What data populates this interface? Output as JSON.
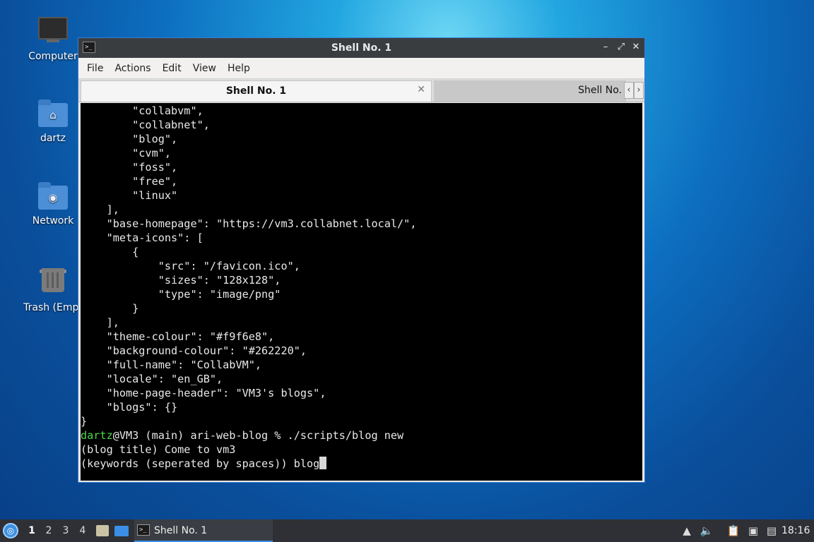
{
  "desktop": {
    "icons": [
      {
        "label": "Computer",
        "icon": "computer-icon"
      },
      {
        "label": "dartz",
        "icon": "home-folder-icon"
      },
      {
        "label": "Network",
        "icon": "network-folder-icon"
      },
      {
        "label": "Trash (Empt",
        "icon": "trash-icon"
      }
    ]
  },
  "window": {
    "title": "Shell No. 1",
    "menu": [
      "File",
      "Actions",
      "Edit",
      "View",
      "Help"
    ],
    "tabs": [
      {
        "label": "Shell No. 1",
        "active": true
      },
      {
        "label": "Shell No.",
        "active": false
      }
    ],
    "terminal_lines": [
      "        \"collabvm\",",
      "        \"collabnet\",",
      "        \"blog\",",
      "        \"cvm\",",
      "        \"foss\",",
      "        \"free\",",
      "        \"linux\"",
      "    ],",
      "    \"base-homepage\": \"https://vm3.collabnet.local/\",",
      "    \"meta-icons\": [",
      "        {",
      "            \"src\": \"/favicon.ico\",",
      "            \"sizes\": \"128x128\",",
      "            \"type\": \"image/png\"",
      "        }",
      "    ],",
      "    \"theme-colour\": \"#f9f6e8\",",
      "    \"background-colour\": \"#262220\",",
      "    \"full-name\": \"CollabVM\",",
      "    \"locale\": \"en_GB\",",
      "    \"home-page-header\": \"VM3's blogs\",",
      "    \"blogs\": {}",
      "}"
    ],
    "prompt": {
      "user": "dartz",
      "rest": "@VM3 (main) ari-web-blog % ./scripts/blog new"
    },
    "after_prompt_lines": [
      "(blog title) Come to vm3",
      "(keywords (seperated by spaces)) blog"
    ]
  },
  "taskbar": {
    "workspaces": [
      "1",
      "2",
      "3",
      "4"
    ],
    "active_workspace": "1",
    "task_label": "Shell No. 1",
    "clock": "18:16"
  },
  "colors": {
    "terminal_bg": "#000000",
    "prompt_user": "#4ed64e",
    "window_border": "#3a7bd0",
    "titlebar": "#3a3d40"
  }
}
